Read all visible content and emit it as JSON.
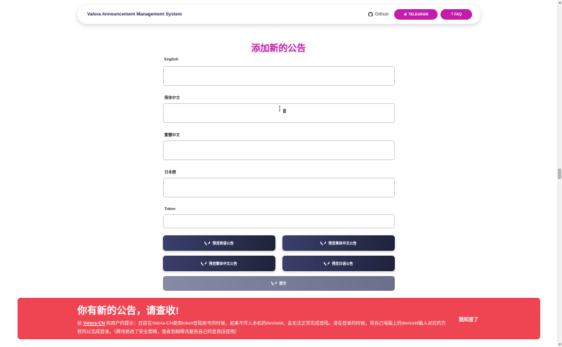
{
  "navbar": {
    "brand": "Valora Announcement Management System",
    "github_label": "Github",
    "telegram_label": "TELEGRAM",
    "faq_label": "FAQ"
  },
  "page": {
    "title": "添加新的公告"
  },
  "form": {
    "fields": [
      {
        "label": "English",
        "value": ""
      },
      {
        "label": "简体中文",
        "value": ""
      },
      {
        "label": "繁體中文",
        "value": ""
      },
      {
        "label": "日本語",
        "value": ""
      }
    ],
    "token_label": "Token",
    "token_value": ""
  },
  "actions": {
    "preview_english": "预览英语公告",
    "preview_simplified": "预览简体中文公告",
    "preview_traditional": "预览繁体中文公告",
    "preview_japanese": "预览日语公告",
    "submit": "提交"
  },
  "notice": {
    "title": "你有新的公告，请查收!",
    "text_prefix": "给 ",
    "link_text": "Valora-CN",
    "text_body": " 的用户的提示：目前在Valora-CN使用token登陆账号的时候，如果不传入本机的deviceid，会无法正常完成登陆。请在登录的时候，将自己电脑上的deviceid输入对应的方框内以完成登录。（腾讯修改了安全策略，我者到邮腾讯服务自己的登商店使用）",
    "dismiss_label": "我知道了"
  },
  "colors": {
    "accent": "#c41cab",
    "notice_bg": "#ef4452",
    "button_dark": "#2a2e4e",
    "button_disabled": "#6c6f89"
  },
  "icons": {
    "github": "github-icon",
    "telegram": "paper-plane-icon",
    "faq": "question-icon",
    "valorant": "valorant-logo-icon"
  }
}
